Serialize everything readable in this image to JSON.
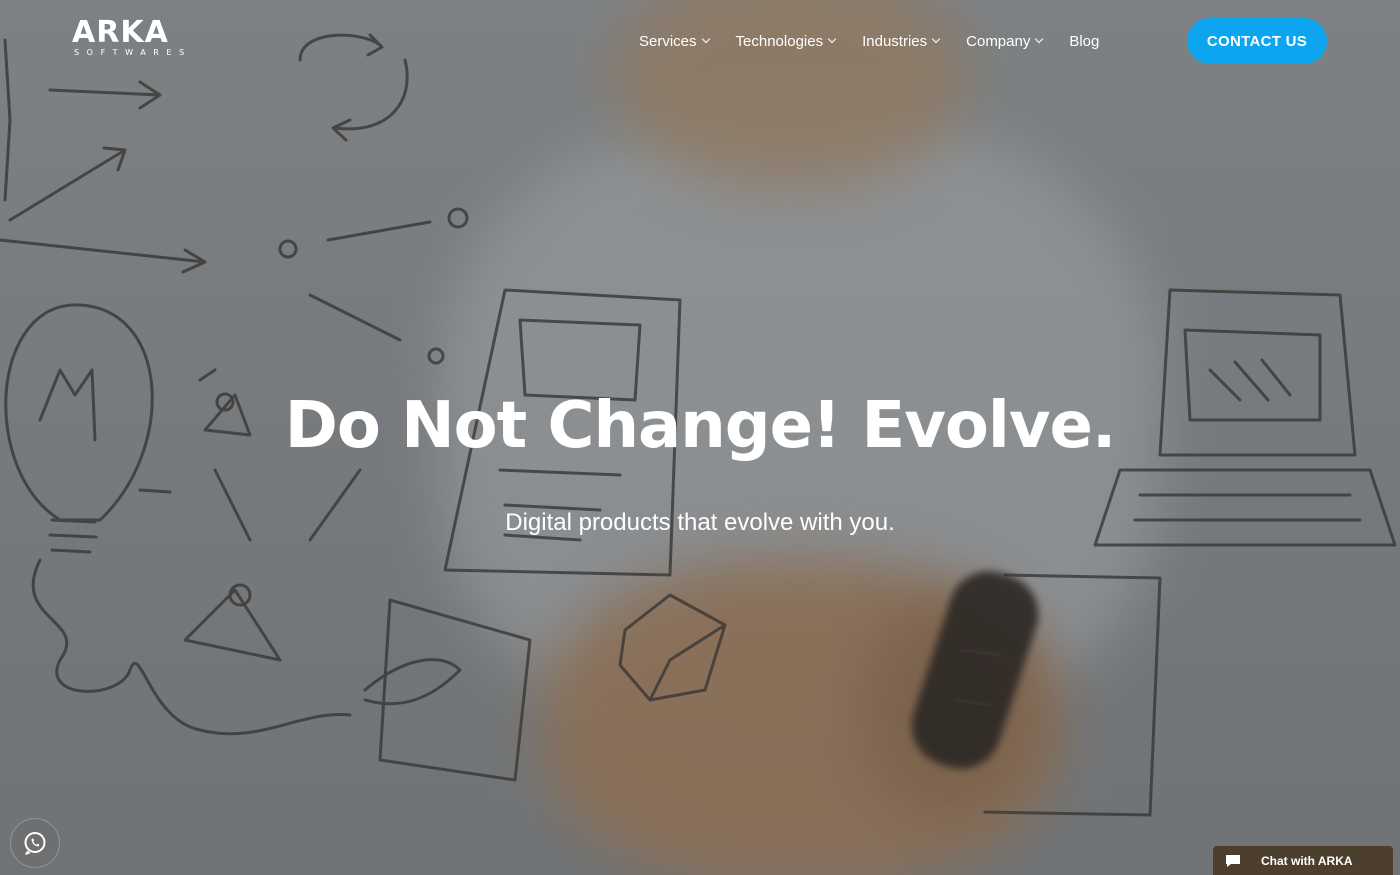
{
  "brand": {
    "logo_word": "ARKA",
    "logo_sub": "SOFTWARES"
  },
  "nav": {
    "items": [
      {
        "label": "Services",
        "has_dropdown": true
      },
      {
        "label": "Technologies",
        "has_dropdown": true
      },
      {
        "label": "Industries",
        "has_dropdown": true
      },
      {
        "label": "Company",
        "has_dropdown": true
      },
      {
        "label": "Blog",
        "has_dropdown": false
      }
    ],
    "cta_label": "CONTACT US"
  },
  "hero": {
    "headline": "Do Not Change! Evolve.",
    "subline": "Digital products that evolve with you."
  },
  "widgets": {
    "whatsapp_icon": "whatsapp-icon",
    "chat_label": "Chat with ARKA",
    "chat_icon": "chat-bubble-icon"
  },
  "colors": {
    "cta": "#0ea5f0",
    "chat_bar": "#4d3f2e",
    "text": "#ffffff"
  }
}
